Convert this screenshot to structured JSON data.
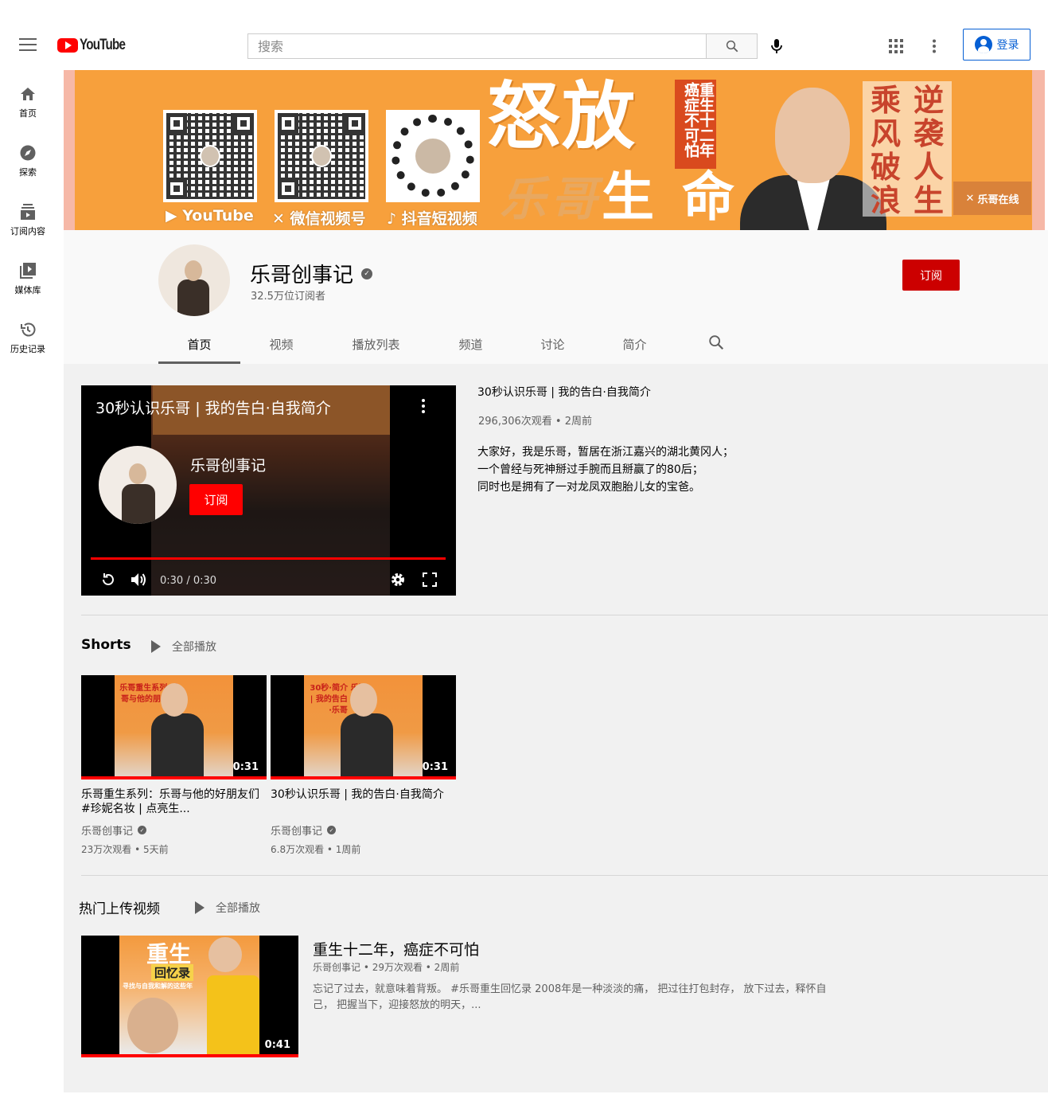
{
  "header": {
    "logo_text": "YouTube",
    "search_placeholder": "搜索",
    "signin_label": "登录"
  },
  "guide": [
    {
      "label": "首页",
      "icon": "home-icon"
    },
    {
      "label": "探索",
      "icon": "compass-icon"
    },
    {
      "label": "订阅内容",
      "icon": "subscriptions-icon"
    },
    {
      "label": "媒体库",
      "icon": "library-icon"
    },
    {
      "label": "历史记录",
      "icon": "history-icon"
    }
  ],
  "banner": {
    "qr_labels": [
      "YouTube",
      "微信视频号",
      "抖音短视频"
    ],
    "title_top": "怒放",
    "title_script": "乐哥",
    "title_bottom": "生 命",
    "vertical_text": "重生十二年癌症不可怕",
    "slogan": [
      "乘",
      "逆",
      "风",
      "袭",
      "破",
      "人",
      "浪",
      "生"
    ],
    "brand": "乐哥在线",
    "colors": {
      "orange": "#f7a03c",
      "pink_edge": "#f6b8a7"
    }
  },
  "channel": {
    "name": "乐哥创事记",
    "subscribers": "32.5万位订阅者",
    "subscribe_label": "订阅",
    "tabs": [
      "首页",
      "视频",
      "播放列表",
      "频道",
      "讨论",
      "简介"
    ]
  },
  "featured": {
    "player_title": "30秒认识乐哥 | 我的告白·自我简介",
    "endscreen_channel": "乐哥创事记",
    "endscreen_subscribe": "订阅",
    "time": "0:30 / 0:30",
    "title": "30秒认识乐哥 | 我的告白·自我简介",
    "views": "296,306次观看 • 2周前",
    "description": [
      "大家好，我是乐哥，暂居在浙江嘉兴的湖北黄冈人；",
      "一个曾经与死神掰过手腕而且掰赢了的80后；",
      "同时也是拥有了一对龙凤双胞胎儿女的宝爸。"
    ]
  },
  "shorts": {
    "title": "Shorts",
    "play_all": "全部播放",
    "items": [
      {
        "title": "乐哥重生系列：乐哥与他的好朋友们#珍妮名妆 | 点亮生...",
        "channel": "乐哥创事记",
        "stats": "23万次观看 • 5天前",
        "duration": "0:31",
        "thumb_text": "乐哥重生系列 乐哥与他的朋友们"
      },
      {
        "title": "30秒认识乐哥 | 我的告白·自我简介",
        "channel": "乐哥创事记",
        "stats": "6.8万次观看 • 1周前",
        "duration": "0:31",
        "thumb_text": "30秒·简介 乐哥 | 我的告白 重生·乐哥"
      }
    ]
  },
  "popular": {
    "title": "热门上传视频",
    "play_all": "全部播放",
    "video": {
      "title": "重生十二年，癌症不可怕",
      "meta": "乐哥创事记 • 29万次观看 • 2周前",
      "description": "忘记了过去，就意味着背叛。 #乐哥重生回忆录 2008年是一种淡淡的痛， 把过往打包封存， 放下过去，释怀自己， 把握当下，迎接怒放的明天，...",
      "duration": "0:41",
      "thumb_text_1": "重生",
      "thumb_text_2": "回忆录",
      "thumb_text_3": "寻找与自我和解的这些年"
    }
  }
}
